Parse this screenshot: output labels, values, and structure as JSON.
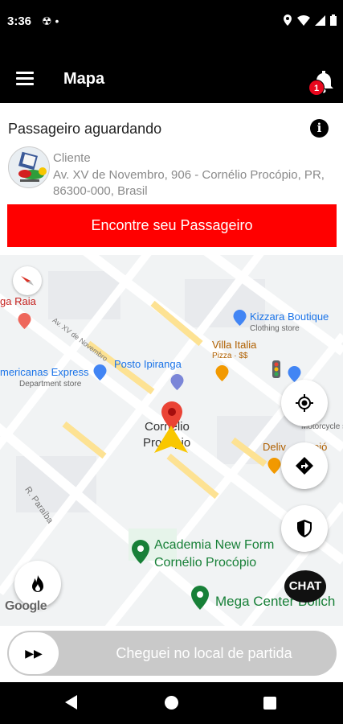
{
  "status_bar": {
    "time": "3:36",
    "left_icons": "☢ •"
  },
  "app_bar": {
    "title": "Mapa",
    "notification_count": "1"
  },
  "card": {
    "title": "Passageiro aguardando",
    "client_label": "Cliente",
    "address": "Av. XV de Novembro, 906 - Cornélio Procópio, PR, 86300-000, Brasil",
    "find_button_label": "Encontre seu Passageiro"
  },
  "map": {
    "pois": {
      "raia": "ga Raia",
      "kizzara": "Kizzara Boutique",
      "kizzara_sub": "Clothing store",
      "villa": "Villa Italia",
      "villa_sub": "Pizza · $$",
      "ipiranga": "Posto Ipiranga",
      "americanas": "mericanas Express",
      "americanas_sub": "Department store",
      "city_line1": "Cornélio",
      "city_line2": "Procópio",
      "delivery": "Deliv",
      "delivery_rest": "ojó",
      "moto_sub": "Motorcycle sho",
      "academia_line1": "Academia New Form",
      "academia_line2": "Cornélio Procópio",
      "mega": "Mega Center Bolich",
      "street_xv": "Av. XV de Novembro",
      "street_paraiba": "R. Paraíba"
    },
    "chat_label": "CHAT",
    "google_logo": "Google"
  },
  "slider": {
    "knob_icon": "▶▶",
    "label": "Cheguei no local de partida"
  },
  "colors": {
    "accent": "#ff0000",
    "appbar": "#000000",
    "poi_blue": "#4285f4",
    "poi_orange": "#f29900",
    "poi_green": "#188038"
  }
}
